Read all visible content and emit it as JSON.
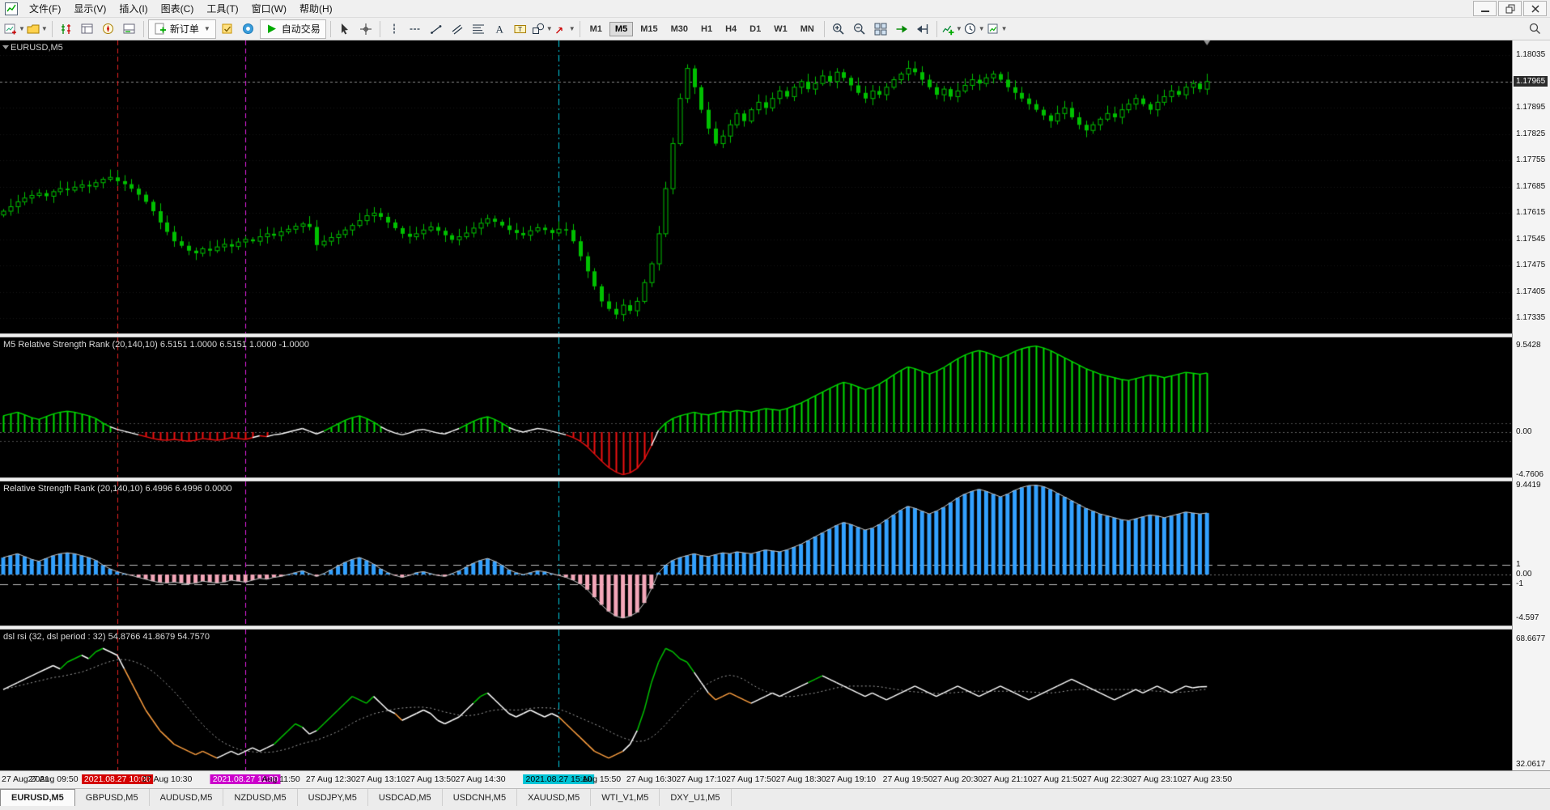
{
  "colors": {
    "bg": "#000000",
    "up": "#00C000",
    "panel1_pos": "#00DD00",
    "panel1_neg": "#EE1111",
    "panel2_pos": "#33A1FF",
    "panel2_neg": "#F4A7B9",
    "panel3_up": "#00C000",
    "panel3_down": "#FFA040",
    "panel3_line": "#FFFFFF",
    "signal": "#A0A0A0",
    "envelope2": "#C8C8C8",
    "vline_red": "#E62020",
    "vline_magenta": "#E020E0",
    "vline_cyan": "#00CFE6"
  },
  "menu": {
    "items": [
      {
        "id": "file",
        "label": "文件(F)"
      },
      {
        "id": "view",
        "label": "显示(V)"
      },
      {
        "id": "insert",
        "label": "插入(I)"
      },
      {
        "id": "charts",
        "label": "图表(C)"
      },
      {
        "id": "tools",
        "label": "工具(T)"
      },
      {
        "id": "window",
        "label": "窗口(W)"
      },
      {
        "id": "help",
        "label": "帮助(H)"
      }
    ]
  },
  "toolbar": {
    "new_order_label": "新订单",
    "auto_trading_label": "自动交易",
    "timeframes": [
      "M1",
      "M5",
      "M15",
      "M30",
      "H1",
      "H4",
      "D1",
      "W1",
      "MN"
    ],
    "active_timeframe": "M5",
    "groups": [
      {
        "buttons": [
          {
            "icon": "new-chart",
            "name": "new-chart",
            "dropdown": true
          },
          {
            "icon": "profiles",
            "name": "profiles",
            "dropdown": true
          }
        ]
      },
      {
        "buttons": [
          {
            "icon": "market-watch",
            "name": "market-watch"
          },
          {
            "icon": "data-window",
            "name": "data-window"
          },
          {
            "icon": "navigator",
            "name": "navigator"
          },
          {
            "icon": "terminal",
            "name": "terminal"
          }
        ]
      },
      {
        "buttons": [
          {
            "icon": "new-order",
            "name": "new-order",
            "labelKey": "new_order_label",
            "dropdown": true
          },
          {
            "icon": "editor",
            "name": "metaeditor"
          },
          {
            "icon": "community",
            "name": "community"
          },
          {
            "icon": "auto-trading",
            "name": "auto-trading",
            "labelKey": "auto_trading_label"
          }
        ]
      },
      {
        "buttons": [
          {
            "icon": "cursor",
            "name": "cursor"
          },
          {
            "icon": "crosshair",
            "name": "crosshair"
          }
        ]
      },
      {
        "buttons": [
          {
            "icon": "vline",
            "name": "vertical-line"
          },
          {
            "icon": "hline",
            "name": "horizontal-line"
          },
          {
            "icon": "trendline",
            "name": "trendline"
          },
          {
            "icon": "channel",
            "name": "equidistant-channel"
          },
          {
            "icon": "fibonacci",
            "name": "fibonacci-retracement"
          },
          {
            "icon": "text",
            "name": "text-tool"
          },
          {
            "icon": "text-label",
            "name": "text-label-tool"
          },
          {
            "icon": "shapes",
            "name": "shapes",
            "dropdown": true
          },
          {
            "icon": "arrows",
            "name": "arrow-tools",
            "dropdown": true
          }
        ]
      },
      {
        "timeframes": true
      },
      {
        "buttons": [
          {
            "icon": "zoom-in",
            "name": "zoom-in"
          },
          {
            "icon": "zoom-out",
            "name": "zoom-out"
          },
          {
            "icon": "tile-windows",
            "name": "tile-windows"
          },
          {
            "icon": "auto-scroll",
            "name": "auto-scroll"
          },
          {
            "icon": "chart-shift",
            "name": "chart-shift"
          }
        ]
      },
      {
        "buttons": [
          {
            "icon": "indicators-add",
            "name": "indicators-list",
            "dropdown": true
          },
          {
            "icon": "periods-clock",
            "name": "period-list",
            "dropdown": true
          },
          {
            "icon": "templates",
            "name": "templates",
            "dropdown": true
          }
        ]
      }
    ]
  },
  "chart": {
    "symbol_label": "EURUSD,M5",
    "price_scale": {
      "ticks": [
        {
          "text": "1.18035",
          "v": 1.18035
        },
        {
          "text": "1.17965",
          "v": 1.17965
        },
        {
          "text": "1.17895",
          "v": 1.17895
        },
        {
          "text": "1.17825",
          "v": 1.17825
        },
        {
          "text": "1.17755",
          "v": 1.17755
        },
        {
          "text": "1.17685",
          "v": 1.17685
        },
        {
          "text": "1.17615",
          "v": 1.17615
        },
        {
          "text": "1.17545",
          "v": 1.17545
        },
        {
          "text": "1.17475",
          "v": 1.17475
        },
        {
          "text": "1.17405",
          "v": 1.17405
        },
        {
          "text": "1.17335",
          "v": 1.17335
        }
      ],
      "current": {
        "text": "1.17965",
        "v": 1.17965
      }
    },
    "panels": [
      {
        "title": "M5 Relative Strength Rank (20,140,10) 6.5151 1.0000 6.5151 1.0000 -1.0000",
        "scale": [
          {
            "text": "9.5428",
            "v": 9.5428
          },
          {
            "text": "0.00",
            "v": 0
          },
          {
            "text": "-4.7606",
            "v": -4.7606
          }
        ]
      },
      {
        "title": "Relative Strength Rank (20,140,10) 6.4996 6.4996 0.0000",
        "scale": [
          {
            "text": "9.4419",
            "v": 9.4419
          },
          {
            "text": "1",
            "v": 1
          },
          {
            "text": "0.00",
            "v": 0
          },
          {
            "text": "-1",
            "v": -1
          },
          {
            "text": "-4.597",
            "v": -4.597
          }
        ]
      },
      {
        "title": "dsl rsi (32, dsl period : 32) 54.8766 41.8679 54.7570",
        "scale": [
          {
            "text": "68.6677",
            "v": 68.6677
          },
          {
            "text": "32.0617",
            "v": 32.0617
          }
        ]
      }
    ],
    "time_axis": {
      "labels": [
        {
          "text": "27 Aug 2021",
          "bar": 0,
          "type": "normal"
        },
        {
          "text": "27 Aug 09:50",
          "bar": 7,
          "type": "normal"
        },
        {
          "text": "2021.08.27 10:00",
          "bar": 16,
          "type": "red"
        },
        {
          "text": "27 Aug 10:30",
          "bar": 23,
          "type": "normal"
        },
        {
          "text": "2021.08.27 11:30",
          "bar": 34,
          "type": "magenta"
        },
        {
          "text": "Aug 11:50",
          "bar": 39,
          "type": "normal"
        },
        {
          "text": "27 Aug 12:30",
          "bar": 46,
          "type": "normal"
        },
        {
          "text": "27 Aug 13:10",
          "bar": 53,
          "type": "normal"
        },
        {
          "text": "27 Aug 13:50",
          "bar": 60,
          "type": "normal"
        },
        {
          "text": "27 Aug 14:30",
          "bar": 67,
          "type": "normal"
        },
        {
          "text": "2021.08.27 15:10",
          "bar": 78,
          "type": "cyan"
        },
        {
          "text": "Aug 15:50",
          "bar": 84,
          "type": "normal"
        },
        {
          "text": "27 Aug 16:30",
          "bar": 91,
          "type": "normal"
        },
        {
          "text": "27 Aug 17:10",
          "bar": 98,
          "type": "normal"
        },
        {
          "text": "27 Aug 17:50",
          "bar": 105,
          "type": "normal"
        },
        {
          "text": "27 Aug 18:30",
          "bar": 112,
          "type": "normal"
        },
        {
          "text": "27 Aug 19:10",
          "bar": 119,
          "type": "normal"
        },
        {
          "text": "27 Aug 19:50",
          "bar": 127,
          "type": "normal"
        },
        {
          "text": "27 Aug 20:30",
          "bar": 134,
          "type": "normal"
        },
        {
          "text": "27 Aug 21:10",
          "bar": 141,
          "type": "normal"
        },
        {
          "text": "27 Aug 21:50",
          "bar": 148,
          "type": "normal"
        },
        {
          "text": "27 Aug 22:30",
          "bar": 155,
          "type": "normal"
        },
        {
          "text": "27 Aug 23:10",
          "bar": 162,
          "type": "normal"
        },
        {
          "text": "27 Aug 23:50",
          "bar": 169,
          "type": "normal"
        }
      ]
    }
  },
  "tabs": [
    {
      "label": "EURUSD,M5",
      "active": true
    },
    {
      "label": "GBPUSD,M5",
      "active": false
    },
    {
      "label": "AUDUSD,M5",
      "active": false
    },
    {
      "label": "NZDUSD,M5",
      "active": false
    },
    {
      "label": "USDJPY,M5",
      "active": false
    },
    {
      "label": "USDCAD,M5",
      "active": false
    },
    {
      "label": "USDCNH,M5",
      "active": false
    },
    {
      "label": "XAUUSD,M5",
      "active": false
    },
    {
      "label": "WTI_V1,M5",
      "active": false
    },
    {
      "label": "DXY_U1,M5",
      "active": false
    }
  ],
  "chart_data": {
    "type": "candlestick",
    "symbol": "EURUSD",
    "period": "M5",
    "vlines": [
      {
        "bar": 16,
        "color": "red",
        "style": "dashed"
      },
      {
        "bar": 34,
        "color": "magenta",
        "style": "dashed"
      },
      {
        "bar": 78,
        "color": "cyan",
        "style": "dashdot"
      }
    ],
    "bars": {
      "closes": [
        1.1762,
        1.17632,
        1.17645,
        1.17655,
        1.17662,
        1.17668,
        1.1766,
        1.17672,
        1.1768,
        1.17676,
        1.17684,
        1.1769,
        1.17686,
        1.17696,
        1.17705,
        1.1771,
        1.177,
        1.17692,
        1.1768,
        1.17664,
        1.17645,
        1.1762,
        1.1759,
        1.17565,
        1.1754,
        1.17528,
        1.17515,
        1.17508,
        1.1752,
        1.17515,
        1.17525,
        1.17532,
        1.17526,
        1.17538,
        1.17545,
        1.1754,
        1.17552,
        1.1756,
        1.17555,
        1.17565,
        1.17572,
        1.1758,
        1.17586,
        1.17578,
        1.1753,
        1.1754,
        1.1755,
        1.17558,
        1.1757,
        1.17582,
        1.17595,
        1.17608,
        1.17615,
        1.17605,
        1.1759,
        1.17575,
        1.1756,
        1.17552,
        1.1756,
        1.1757,
        1.17578,
        1.17568,
        1.17556,
        1.17544,
        1.17552,
        1.17562,
        1.17575,
        1.17588,
        1.176,
        1.17592,
        1.17582,
        1.1757,
        1.17562,
        1.17556,
        1.17568,
        1.17576,
        1.1757,
        1.17562,
        1.17572,
        1.1757,
        1.1754,
        1.175,
        1.1746,
        1.1742,
        1.1738,
        1.1736,
        1.17345,
        1.1737,
        1.17355,
        1.1738,
        1.1743,
        1.1748,
        1.1756,
        1.1768,
        1.178,
        1.1792,
        1.18,
        1.1795,
        1.1789,
        1.1784,
        1.178,
        1.1782,
        1.1785,
        1.1788,
        1.1786,
        1.1789,
        1.1791,
        1.17895,
        1.1792,
        1.1794,
        1.17925,
        1.1795,
        1.17965,
        1.17945,
        1.1796,
        1.1798,
        1.17965,
        1.1799,
        1.17975,
        1.17955,
        1.17935,
        1.1792,
        1.1794,
        1.1793,
        1.1795,
        1.1797,
        1.17985,
        1.18,
        1.1799,
        1.1797,
        1.1795,
        1.1793,
        1.17945,
        1.17925,
        1.1794,
        1.17955,
        1.1797,
        1.1796,
        1.17975,
        1.17985,
        1.1797,
        1.1795,
        1.17935,
        1.1792,
        1.17905,
        1.1789,
        1.17875,
        1.1786,
        1.1788,
        1.17895,
        1.1787,
        1.1785,
        1.17835,
        1.1785,
        1.17865,
        1.1788,
        1.1787,
        1.1789,
        1.17905,
        1.1792,
        1.17905,
        1.1789,
        1.1791,
        1.17925,
        1.1794,
        1.1793,
        1.1795,
        1.1796,
        1.17945,
        1.17965
      ]
    },
    "panel1": {
      "name": "M5 Relative Strength Rank",
      "values": [
        1.8,
        2.0,
        2.2,
        1.9,
        1.6,
        1.4,
        1.7,
        2.0,
        2.2,
        2.3,
        2.2,
        2.0,
        1.8,
        1.5,
        1.0,
        0.6,
        0.3,
        0.1,
        -0.1,
        -0.3,
        -0.5,
        -0.7,
        -0.85,
        -0.9,
        -0.8,
        -0.9,
        -1.0,
        -0.9,
        -0.7,
        -0.8,
        -0.9,
        -0.8,
        -0.6,
        -0.7,
        -0.8,
        -0.6,
        -0.4,
        -0.5,
        -0.3,
        -0.2,
        0.0,
        0.2,
        0.4,
        0.1,
        -0.2,
        0.1,
        0.5,
        0.9,
        1.3,
        1.6,
        1.8,
        1.5,
        1.1,
        0.6,
        0.2,
        -0.1,
        -0.3,
        -0.1,
        0.2,
        0.3,
        0.1,
        -0.1,
        -0.2,
        0.1,
        0.4,
        0.8,
        1.2,
        1.5,
        1.7,
        1.4,
        1.0,
        0.5,
        0.2,
        0.0,
        0.2,
        0.4,
        0.3,
        0.1,
        -0.1,
        -0.3,
        -0.6,
        -1.0,
        -1.6,
        -2.4,
        -3.2,
        -3.9,
        -4.4,
        -4.7,
        -4.5,
        -4.0,
        -3.0,
        -1.5,
        0.2,
        1.0,
        1.5,
        1.8,
        2.0,
        2.2,
        2.0,
        1.9,
        2.1,
        2.3,
        2.2,
        2.4,
        2.3,
        2.2,
        2.4,
        2.6,
        2.5,
        2.4,
        2.6,
        2.9,
        3.2,
        3.6,
        4.0,
        4.4,
        4.8,
        5.2,
        5.5,
        5.3,
        5.0,
        4.7,
        4.9,
        5.3,
        5.8,
        6.3,
        6.8,
        7.2,
        7.0,
        6.7,
        6.4,
        6.7,
        7.1,
        7.6,
        8.1,
        8.5,
        8.8,
        9.0,
        8.8,
        8.5,
        8.2,
        8.5,
        8.9,
        9.2,
        9.4,
        9.5,
        9.3,
        9.0,
        8.6,
        8.2,
        7.8,
        7.4,
        7.0,
        6.7,
        6.4,
        6.2,
        6.0,
        5.8,
        5.7,
        5.9,
        6.1,
        6.3,
        6.2,
        6.0,
        6.2,
        6.4,
        6.6,
        6.5,
        6.4,
        6.5151
      ]
    },
    "panel2": {
      "name": "Relative Strength Rank",
      "values": [
        1.8,
        2.0,
        2.2,
        1.9,
        1.6,
        1.4,
        1.7,
        2.0,
        2.2,
        2.3,
        2.2,
        2.0,
        1.8,
        1.5,
        1.0,
        0.6,
        0.3,
        0.1,
        -0.1,
        -0.3,
        -0.5,
        -0.7,
        -0.85,
        -0.9,
        -0.8,
        -0.9,
        -1.0,
        -0.9,
        -0.7,
        -0.8,
        -0.9,
        -0.8,
        -0.6,
        -0.7,
        -0.8,
        -0.6,
        -0.4,
        -0.5,
        -0.3,
        -0.2,
        0.0,
        0.2,
        0.4,
        0.1,
        -0.2,
        0.1,
        0.5,
        0.9,
        1.3,
        1.6,
        1.8,
        1.5,
        1.1,
        0.6,
        0.2,
        -0.1,
        -0.3,
        -0.1,
        0.2,
        0.3,
        0.1,
        -0.1,
        -0.2,
        0.1,
        0.4,
        0.8,
        1.2,
        1.5,
        1.7,
        1.4,
        1.0,
        0.5,
        0.2,
        0.0,
        0.2,
        0.4,
        0.3,
        0.1,
        -0.1,
        -0.3,
        -0.6,
        -1.0,
        -1.6,
        -2.4,
        -3.2,
        -3.9,
        -4.4,
        -4.6,
        -4.4,
        -4.0,
        -3.0,
        -1.5,
        0.2,
        1.0,
        1.5,
        1.8,
        2.0,
        2.2,
        2.0,
        1.9,
        2.1,
        2.3,
        2.2,
        2.4,
        2.3,
        2.2,
        2.4,
        2.6,
        2.5,
        2.4,
        2.6,
        2.9,
        3.2,
        3.6,
        4.0,
        4.4,
        4.8,
        5.2,
        5.5,
        5.3,
        5.0,
        4.7,
        4.9,
        5.3,
        5.8,
        6.3,
        6.8,
        7.2,
        7.0,
        6.7,
        6.4,
        6.7,
        7.1,
        7.6,
        8.1,
        8.5,
        8.8,
        9.0,
        8.8,
        8.5,
        8.2,
        8.5,
        8.9,
        9.2,
        9.4,
        9.44,
        9.3,
        9.0,
        8.6,
        8.2,
        7.8,
        7.4,
        7.0,
        6.7,
        6.4,
        6.2,
        6.0,
        5.8,
        5.7,
        5.9,
        6.1,
        6.3,
        6.2,
        6.0,
        6.2,
        6.4,
        6.6,
        6.5,
        6.4,
        6.4996
      ]
    },
    "panel3": {
      "name": "dsl rsi",
      "signal_smoothing": 12,
      "values": [
        54,
        55,
        56,
        57,
        58,
        59,
        60,
        61,
        60,
        62,
        63,
        64,
        63,
        65,
        66,
        65,
        64,
        60,
        56,
        52,
        48,
        45,
        42,
        40,
        38,
        37,
        36,
        35,
        36,
        35,
        34,
        35,
        36,
        35,
        36,
        37,
        36,
        37,
        38,
        40,
        42,
        44,
        43,
        41,
        42,
        44,
        46,
        48,
        50,
        52,
        51,
        50,
        52,
        50,
        48,
        47,
        45,
        46,
        47,
        48,
        47,
        45,
        44,
        45,
        46,
        48,
        50,
        52,
        53,
        51,
        49,
        47,
        46,
        47,
        48,
        47,
        46,
        47,
        46,
        44,
        42,
        40,
        38,
        36,
        35,
        34,
        35,
        36,
        38,
        42,
        48,
        56,
        62,
        66,
        65,
        63,
        62,
        59,
        56,
        53,
        51,
        52,
        53,
        52,
        51,
        50,
        51,
        52,
        53,
        52,
        53,
        54,
        55,
        56,
        57,
        58,
        57,
        56,
        55,
        54,
        53,
        52,
        53,
        52,
        51,
        52,
        53,
        54,
        55,
        54,
        53,
        52,
        53,
        54,
        55,
        54,
        53,
        52,
        53,
        54,
        55,
        54,
        53,
        52,
        51,
        52,
        53,
        54,
        55,
        56,
        57,
        56,
        55,
        54,
        53,
        52,
        51,
        52,
        53,
        54,
        53,
        54,
        55,
        54,
        53,
        54,
        55,
        54.5,
        54.8,
        54.8766
      ]
    }
  }
}
